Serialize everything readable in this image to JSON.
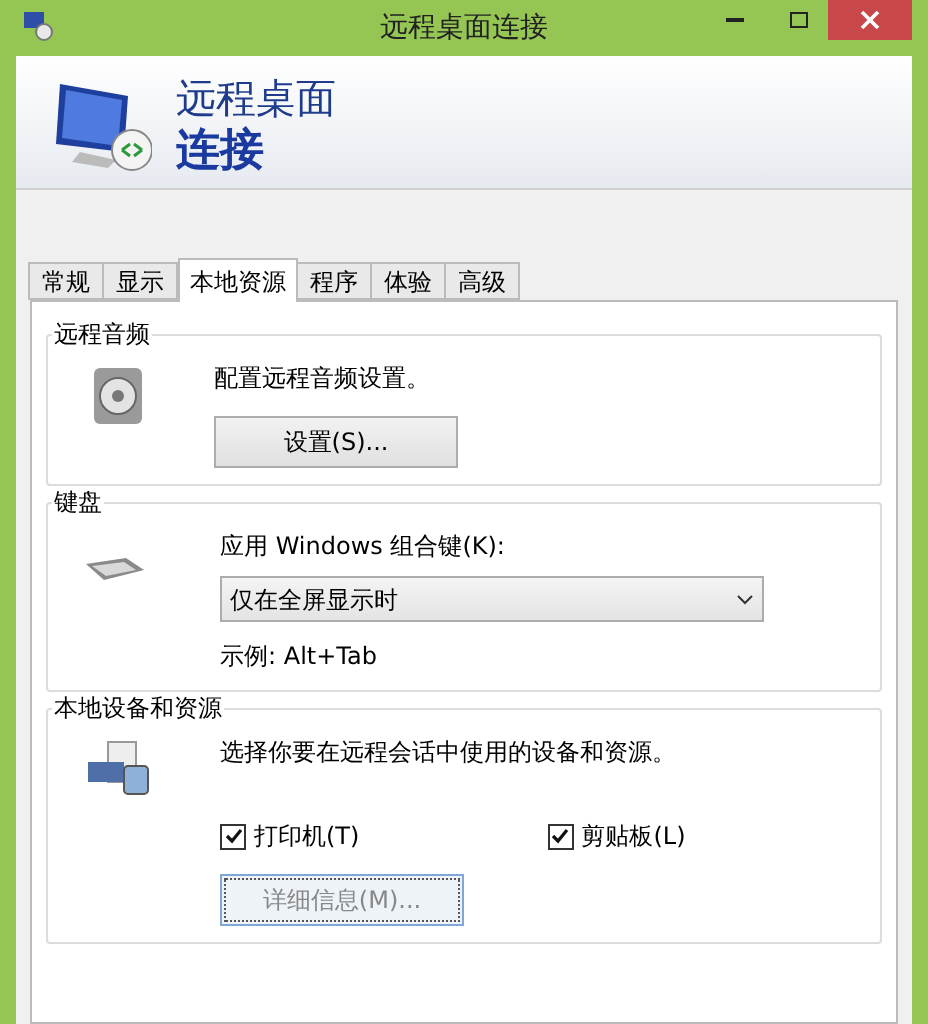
{
  "window": {
    "title": "远程桌面连接"
  },
  "header": {
    "line1": "远程桌面",
    "line2": "连接"
  },
  "tabs": [
    {
      "label": "常规",
      "selected": false
    },
    {
      "label": "显示",
      "selected": false
    },
    {
      "label": "本地资源",
      "selected": true
    },
    {
      "label": "程序",
      "selected": false
    },
    {
      "label": "体验",
      "selected": false
    },
    {
      "label": "高级",
      "selected": false
    }
  ],
  "audio": {
    "title": "远程音频",
    "description": "配置远程音频设置。",
    "button": "设置(S)..."
  },
  "keyboard": {
    "title": "键盘",
    "label": "应用 Windows 组合键(K):",
    "dropdown": "仅在全屏显示时",
    "example": "示例: Alt+Tab"
  },
  "devices": {
    "title": "本地设备和资源",
    "description": "选择你要在远程会话中使用的设备和资源。",
    "checkboxes": [
      {
        "label": "打印机(T)",
        "checked": true
      },
      {
        "label": "剪贴板(L)",
        "checked": true
      }
    ],
    "button": {
      "label": "详细信息(M)...",
      "focused": true
    }
  }
}
